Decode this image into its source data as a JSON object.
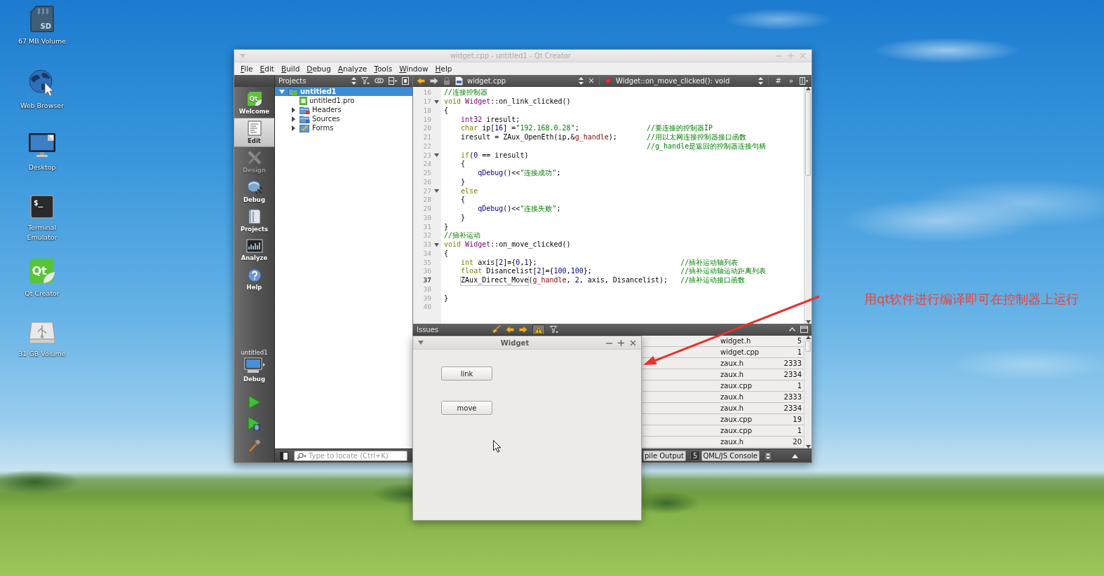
{
  "desktop_icons": [
    {
      "kind": "sd-card",
      "glyph": "SD",
      "label": "67 MB Volume"
    },
    {
      "kind": "globe",
      "label": "Web Browser"
    },
    {
      "kind": "monitor",
      "label": "Desktop"
    },
    {
      "kind": "terminal",
      "glyph": "$_",
      "label": "Terminal Emulator"
    },
    {
      "kind": "qt",
      "glyph": "Qt",
      "label": "Qt Creator"
    },
    {
      "kind": "drive",
      "label": "31 GB Volume"
    }
  ],
  "qt_creator": {
    "title": "widget.cpp - untitled1 - Qt Creator",
    "menu": [
      "File",
      "Edit",
      "Build",
      "Debug",
      "Analyze",
      "Tools",
      "Window",
      "Help"
    ],
    "modes": [
      {
        "kind": "welcome",
        "glyph": "Qt",
        "label": "Welcome",
        "selected": false,
        "disabled": false
      },
      {
        "kind": "edit",
        "label": "Edit",
        "selected": true,
        "disabled": false
      },
      {
        "kind": "design",
        "label": "Design",
        "selected": false,
        "disabled": true
      },
      {
        "kind": "debug",
        "label": "Debug",
        "selected": false,
        "disabled": false
      },
      {
        "kind": "projects",
        "label": "Projects",
        "selected": false,
        "disabled": false
      },
      {
        "kind": "analyze",
        "label": "Analyze",
        "selected": false,
        "disabled": false
      },
      {
        "kind": "help",
        "label": "Help",
        "selected": false,
        "disabled": false
      }
    ],
    "kit": {
      "project": "untitled1",
      "build": "Debug"
    },
    "projects": {
      "title": "Projects",
      "tree": [
        {
          "kind": "project",
          "label": "untitled1",
          "selected": true,
          "expanded": true,
          "children": [
            {
              "kind": "pro-file",
              "label": "untitled1.pro",
              "selected": false
            },
            {
              "kind": "headers",
              "label": "Headers",
              "selected": false,
              "expanded": false
            },
            {
              "kind": "sources",
              "label": "Sources",
              "selected": false,
              "expanded": false
            },
            {
              "kind": "forms",
              "label": "Forms",
              "selected": false,
              "expanded": false
            }
          ]
        }
      ]
    },
    "editor": {
      "file": "widget.cpp",
      "symbol": "Widget::on_move_clicked(): void",
      "toolbar_glyphs": [
        "#",
        "»"
      ],
      "lines": [
        {
          "number": "16",
          "fold": false,
          "current": false,
          "tokens": [
            {
              "kind": "comment",
              "text": "//连接控制器"
            }
          ]
        },
        {
          "number": "17",
          "fold": true,
          "current": false,
          "tokens": [
            {
              "kind": "keyword",
              "text": "void "
            },
            {
              "kind": "type",
              "text": "Widget"
            },
            {
              "kind": "plain",
              "text": "::on_link_clicked()"
            }
          ]
        },
        {
          "number": "18",
          "fold": false,
          "current": false,
          "tokens": [
            {
              "kind": "plain",
              "text": "{"
            }
          ]
        },
        {
          "number": "19",
          "fold": false,
          "current": false,
          "tokens": [
            {
              "kind": "type",
              "text": "    int32"
            },
            {
              "kind": "plain",
              "text": " iresult;"
            }
          ]
        },
        {
          "number": "20",
          "fold": false,
          "current": false,
          "tokens": [
            {
              "kind": "keyword",
              "text": "    char"
            },
            {
              "kind": "plain",
              "text": " ip["
            },
            {
              "kind": "number",
              "text": "16"
            },
            {
              "kind": "plain",
              "text": "] ="
            },
            {
              "kind": "string",
              "text": "\"192.168.0.28\""
            },
            {
              "kind": "plain",
              "text": ";                "
            },
            {
              "kind": "comment",
              "text": "//要连接的控制器IP"
            }
          ]
        },
        {
          "number": "21",
          "fold": false,
          "current": false,
          "tokens": [
            {
              "kind": "plain",
              "text": "    iresult = ZAux_OpenEth(ip,&"
            },
            {
              "kind": "global",
              "text": "g_handle"
            },
            {
              "kind": "plain",
              "text": ");       "
            },
            {
              "kind": "comment",
              "text": "//用以太网连接控制器接口函数"
            }
          ]
        },
        {
          "number": "22",
          "fold": false,
          "current": false,
          "tokens": [
            {
              "kind": "comment",
              "text": "                                                //g_handle是返回的控制器连接句柄"
            }
          ]
        },
        {
          "number": "23",
          "fold": true,
          "current": false,
          "tokens": [
            {
              "kind": "keyword",
              "text": "    if"
            },
            {
              "kind": "plain",
              "text": "("
            },
            {
              "kind": "number",
              "text": "0"
            },
            {
              "kind": "plain",
              "text": " == iresult)"
            }
          ]
        },
        {
          "number": "24",
          "fold": false,
          "current": false,
          "tokens": [
            {
              "kind": "plain",
              "text": "    {"
            }
          ]
        },
        {
          "number": "25",
          "fold": false,
          "current": false,
          "tokens": [
            {
              "kind": "function",
              "text": "        qDebug"
            },
            {
              "kind": "plain",
              "text": "()<<"
            },
            {
              "kind": "string",
              "text": "\"连接成功\""
            },
            {
              "kind": "plain",
              "text": ";"
            }
          ]
        },
        {
          "number": "26",
          "fold": false,
          "current": false,
          "tokens": [
            {
              "kind": "plain",
              "text": "    }"
            }
          ]
        },
        {
          "number": "27",
          "fold": true,
          "current": false,
          "tokens": [
            {
              "kind": "keyword",
              "text": "    else"
            }
          ]
        },
        {
          "number": "28",
          "fold": false,
          "current": false,
          "tokens": [
            {
              "kind": "plain",
              "text": "    {"
            }
          ]
        },
        {
          "number": "29",
          "fold": false,
          "current": false,
          "tokens": [
            {
              "kind": "function",
              "text": "        qDebug"
            },
            {
              "kind": "plain",
              "text": "()<<"
            },
            {
              "kind": "string",
              "text": "\"连接失败\""
            },
            {
              "kind": "plain",
              "text": ";"
            }
          ]
        },
        {
          "number": "30",
          "fold": false,
          "current": false,
          "tokens": [
            {
              "kind": "plain",
              "text": "    }"
            }
          ]
        },
        {
          "number": "31",
          "fold": false,
          "current": false,
          "tokens": [
            {
              "kind": "plain",
              "text": "}"
            }
          ]
        },
        {
          "number": "32",
          "fold": false,
          "current": false,
          "tokens": [
            {
              "kind": "comment",
              "text": "//插补运动"
            }
          ]
        },
        {
          "number": "33",
          "fold": true,
          "current": false,
          "tokens": [
            {
              "kind": "keyword",
              "text": "void "
            },
            {
              "kind": "type",
              "text": "Widget"
            },
            {
              "kind": "plain",
              "text": "::on_move_clicked()"
            }
          ]
        },
        {
          "number": "34",
          "fold": false,
          "current": false,
          "tokens": [
            {
              "kind": "plain",
              "text": "{"
            }
          ]
        },
        {
          "number": "35",
          "fold": false,
          "current": false,
          "tokens": [
            {
              "kind": "keyword",
              "text": "    int"
            },
            {
              "kind": "plain",
              "text": " axis["
            },
            {
              "kind": "number",
              "text": "2"
            },
            {
              "kind": "plain",
              "text": "]={"
            },
            {
              "kind": "number",
              "text": "0"
            },
            {
              "kind": "plain",
              "text": ","
            },
            {
              "kind": "number",
              "text": "1"
            },
            {
              "kind": "plain",
              "text": "};                                  "
            },
            {
              "kind": "comment",
              "text": "//插补运动轴列表"
            }
          ]
        },
        {
          "number": "36",
          "fold": false,
          "current": false,
          "tokens": [
            {
              "kind": "keyword",
              "text": "    float"
            },
            {
              "kind": "plain",
              "text": " Disancelist["
            },
            {
              "kind": "number",
              "text": "2"
            },
            {
              "kind": "plain",
              "text": "]={"
            },
            {
              "kind": "number",
              "text": "100"
            },
            {
              "kind": "plain",
              "text": ","
            },
            {
              "kind": "number",
              "text": "100"
            },
            {
              "kind": "plain",
              "text": "};                     "
            },
            {
              "kind": "comment",
              "text": "//插补运动轴运动距离列表"
            }
          ]
        },
        {
          "number": "37",
          "fold": false,
          "current": true,
          "tokens": [
            {
              "kind": "symbol",
              "text": "    ZAux_Direct_Move"
            },
            {
              "kind": "plain",
              "text": "("
            },
            {
              "kind": "global",
              "text": "g_handle"
            },
            {
              "kind": "plain",
              "text": ", "
            },
            {
              "kind": "number",
              "text": "2"
            },
            {
              "kind": "plain",
              "text": ", axis, Disancelist);   "
            },
            {
              "kind": "comment",
              "text": "//插补运动接口函数"
            }
          ]
        },
        {
          "number": "38",
          "fold": false,
          "current": false
        },
        {
          "number": "39",
          "fold": false,
          "current": false,
          "tokens": [
            {
              "kind": "plain",
              "text": "}"
            }
          ]
        },
        {
          "number": "40",
          "fold": false,
          "current": false
        }
      ]
    },
    "issues": {
      "title": "Issues",
      "show_warnings": true,
      "rows": [
        {
          "file": "widget.h",
          "line": "5"
        },
        {
          "file": "widget.cpp",
          "line": "1"
        },
        {
          "file": "zaux.h",
          "line": "2333"
        },
        {
          "file": "zaux.h",
          "line": "2334"
        },
        {
          "file": "zaux.cpp",
          "line": "1"
        },
        {
          "file": "zaux.h",
          "line": "2333"
        },
        {
          "file": "zaux.h",
          "line": "2334"
        },
        {
          "file": "zaux.cpp",
          "line": "19"
        },
        {
          "file": "zaux.cpp",
          "line": "1"
        },
        {
          "file": "zaux.h",
          "line": "20"
        }
      ]
    },
    "locator": {
      "placeholder": "Type to locate (Ctrl+K)"
    },
    "output_tabs": [
      {
        "label": "pile Output",
        "selected": false
      },
      {
        "number": "5",
        "label": "QML/JS Console",
        "selected": false
      }
    ]
  },
  "widget_window": {
    "title": "Widget",
    "buttons": [
      "link",
      "move"
    ]
  },
  "annotation": "用qt软件进行编译即可在控制器上运行"
}
